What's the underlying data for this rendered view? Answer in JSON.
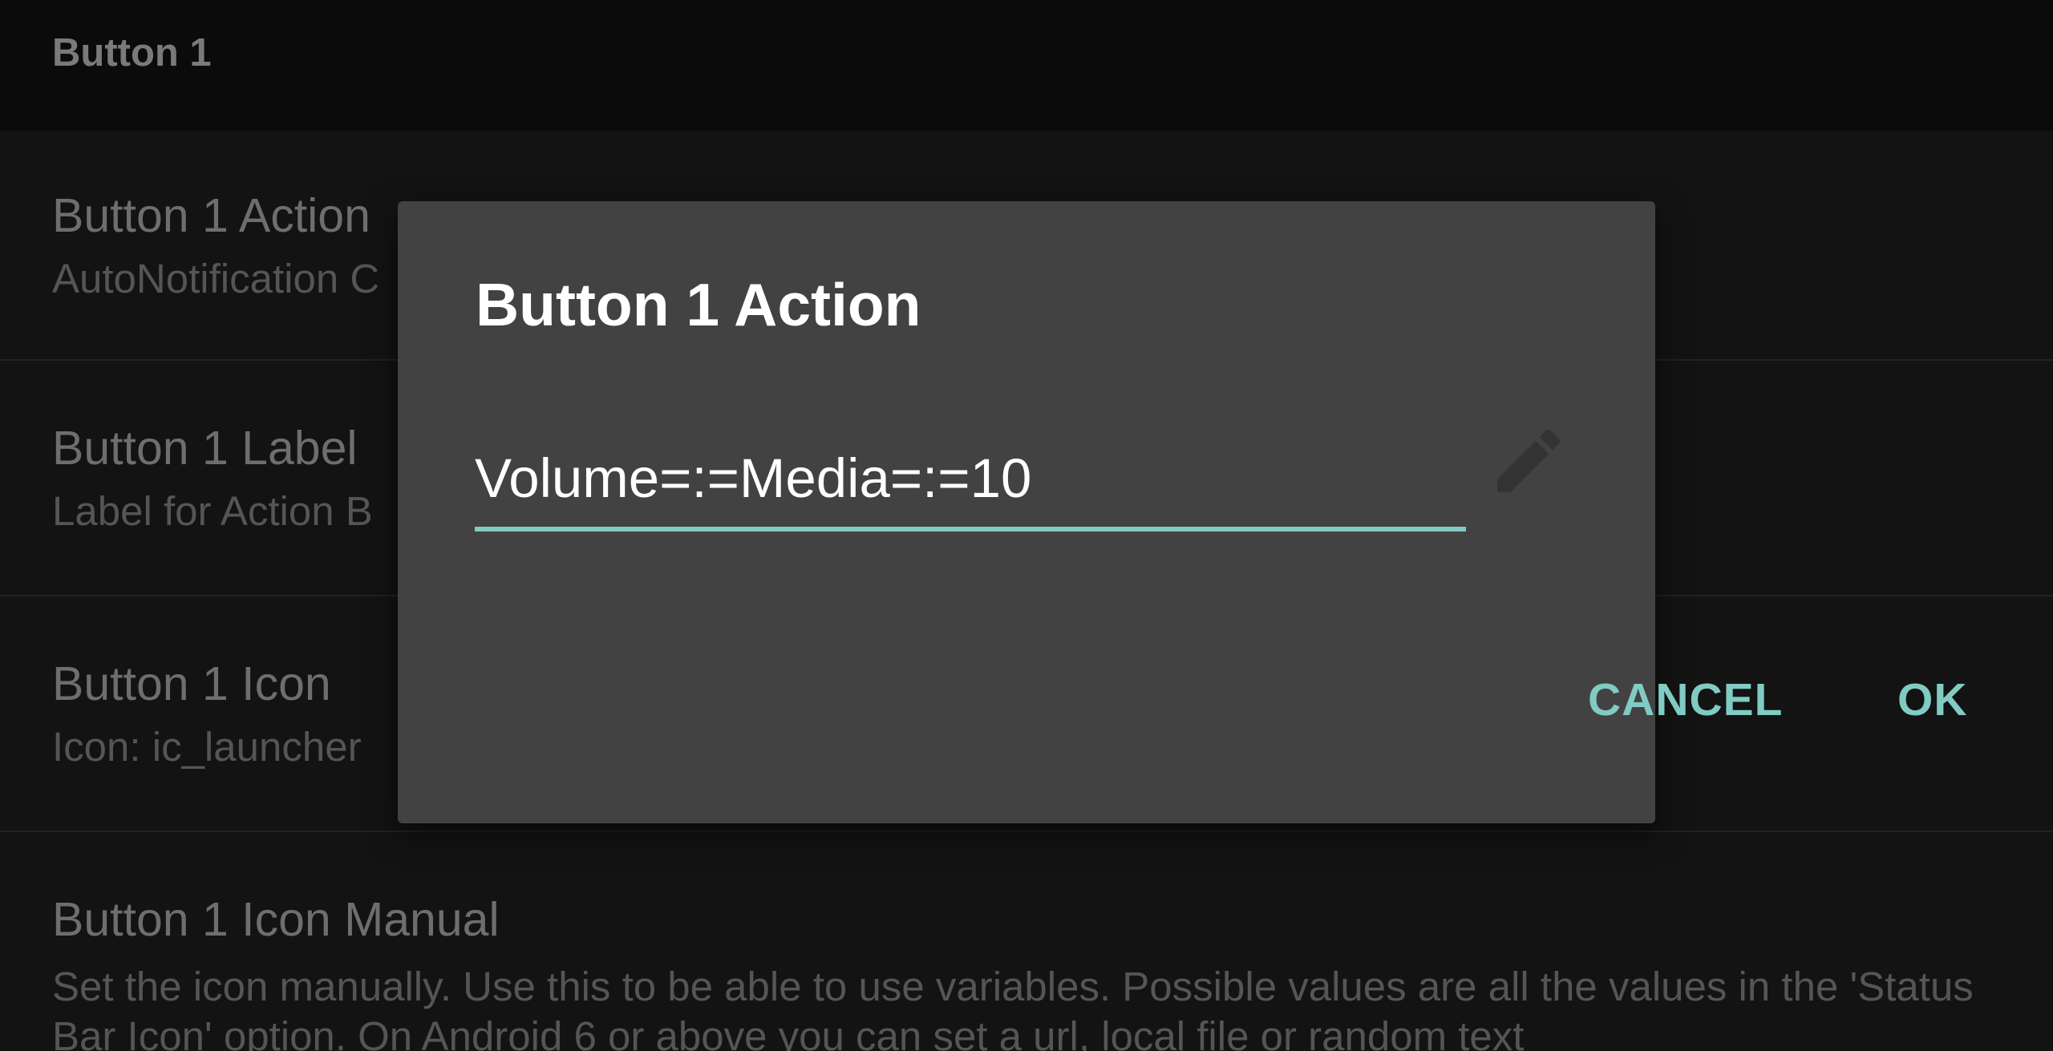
{
  "header": {
    "title": "Button 1"
  },
  "preferences": [
    {
      "title": "Button 1 Action",
      "summary": "AutoNotification C"
    },
    {
      "title": "Button 1 Label",
      "summary": "Label for Action B"
    },
    {
      "title": "Button 1 Icon",
      "summary": "Icon: ic_launcher"
    },
    {
      "title": "Button 1 Icon Manual",
      "summary": "Set the icon manually. Use this to be able to use variables. Possible values are all the values in the 'Status Bar Icon' option. On Android 6 or above you can set a url, local file or random text"
    }
  ],
  "dialog": {
    "title": "Button 1 Action",
    "input_value": "Volume=:=Media=:=10",
    "edit_icon": "pencil-icon",
    "cancel_label": "CANCEL",
    "ok_label": "OK"
  },
  "colors": {
    "accent": "#80cbc4",
    "dialog_bg": "#424242",
    "screen_bg": "#131313"
  }
}
